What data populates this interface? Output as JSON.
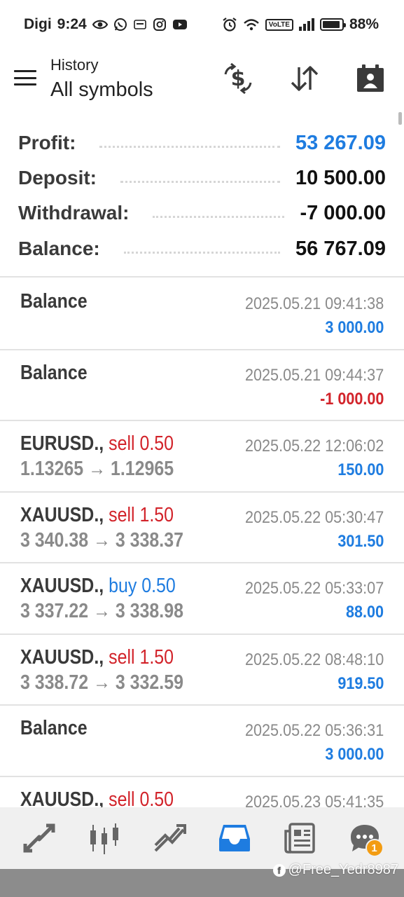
{
  "status_bar": {
    "carrier": "Digi",
    "time": "9:24",
    "volte": "VoLTE",
    "battery": "88%"
  },
  "header": {
    "subtitle": "History",
    "title": "All symbols"
  },
  "summary": {
    "profit_label": "Profit:",
    "profit_value": "53 267.09",
    "deposit_label": "Deposit:",
    "deposit_value": "10 500.00",
    "withdrawal_label": "Withdrawal:",
    "withdrawal_value": "-7 000.00",
    "balance_label": "Balance:",
    "balance_value": "56 767.09"
  },
  "rows": [
    {
      "kind": "balance",
      "title": "Balance",
      "time": "2025.05.21 09:41:38",
      "amount": "3 000.00",
      "sign": "pos"
    },
    {
      "kind": "balance",
      "title": "Balance",
      "time": "2025.05.21 09:44:37",
      "amount": "-1 000.00",
      "sign": "neg"
    },
    {
      "kind": "trade",
      "symbol": "EURUSD.,",
      "side": "sell 0.50",
      "side_type": "sell",
      "prices": "1.13265 → 1.12965",
      "time": "2025.05.22 12:06:02",
      "amount": "150.00",
      "sign": "pos"
    },
    {
      "kind": "trade",
      "symbol": "XAUUSD.,",
      "side": "sell 1.50",
      "side_type": "sell",
      "prices": "3 340.38 → 3 338.37",
      "time": "2025.05.22 05:30:47",
      "amount": "301.50",
      "sign": "pos"
    },
    {
      "kind": "trade",
      "symbol": "XAUUSD.,",
      "side": "buy 0.50",
      "side_type": "buy",
      "prices": "3 337.22 → 3 338.98",
      "time": "2025.05.22 05:33:07",
      "amount": "88.00",
      "sign": "pos"
    },
    {
      "kind": "trade",
      "symbol": "XAUUSD.,",
      "side": "sell 1.50",
      "side_type": "sell",
      "prices": "3 338.72 → 3 332.59",
      "time": "2025.05.22 08:48:10",
      "amount": "919.50",
      "sign": "pos"
    },
    {
      "kind": "balance",
      "title": "Balance",
      "time": "2025.05.22 05:36:31",
      "amount": "3 000.00",
      "sign": "pos"
    },
    {
      "kind": "trade",
      "symbol": "XAUUSD.,",
      "side": "sell 0.50",
      "side_type": "sell",
      "prices": "",
      "time": "2025.05.23 05:41:35",
      "amount": "",
      "sign": "pos"
    }
  ],
  "bottom_nav": {
    "items": [
      "quotes-icon",
      "chart-icon",
      "trade-icon",
      "history-icon",
      "news-icon",
      "messages-icon"
    ],
    "active": "history-icon",
    "badge": "1"
  },
  "colors": {
    "accent_blue": "#1e7ce0",
    "sell_red": "#d2232a",
    "badge_orange": "#f39c12"
  },
  "watermark": "@Free_Yedr8987"
}
